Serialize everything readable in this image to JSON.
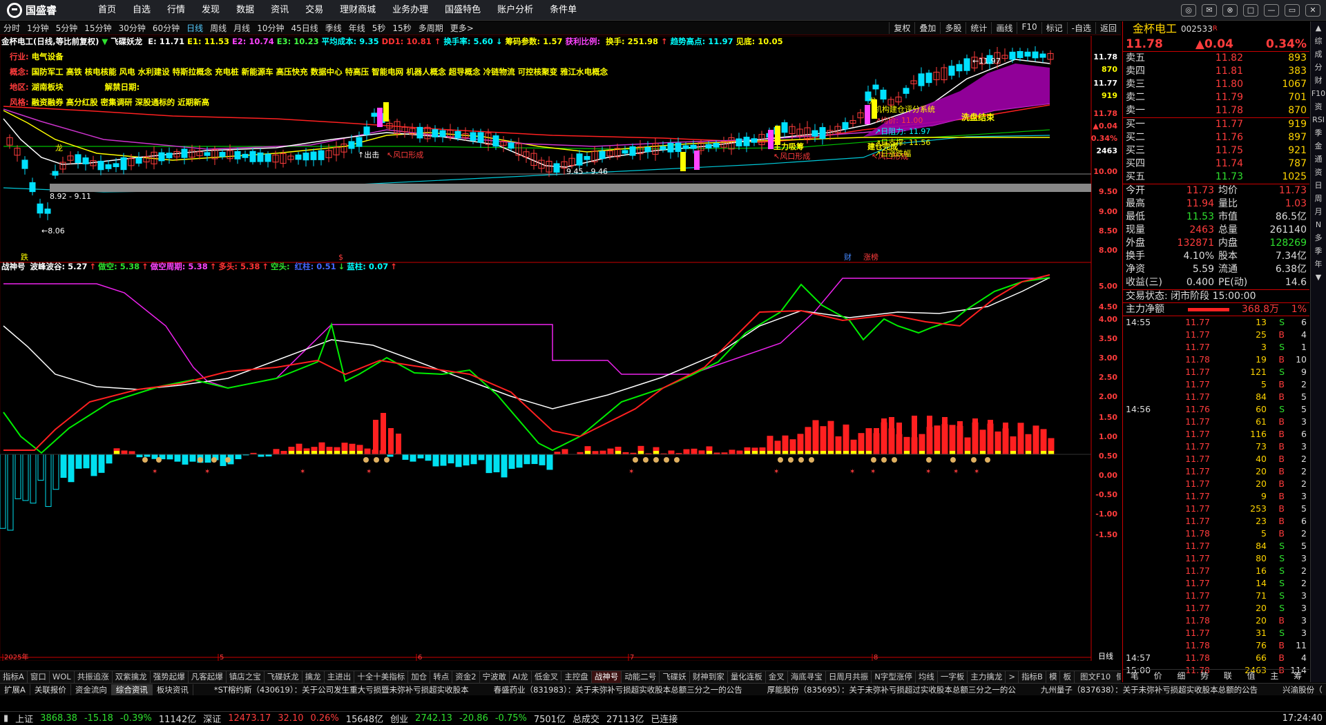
{
  "app": {
    "logo_text": "国盛睿"
  },
  "menu": [
    "首页",
    "自选",
    "行情",
    "发现",
    "数据",
    "资讯",
    "交易",
    "理财商城",
    "业务办理",
    "国盛特色",
    "账户分析",
    "条件单"
  ],
  "window_controls": [
    "◎",
    "✉",
    "⊗",
    "□",
    "—",
    "▭",
    "✕"
  ],
  "periods": [
    {
      "label": "分时",
      "on": false
    },
    {
      "label": "1分钟",
      "on": false
    },
    {
      "label": "5分钟",
      "on": false
    },
    {
      "label": "15分钟",
      "on": false
    },
    {
      "label": "30分钟",
      "on": false
    },
    {
      "label": "60分钟",
      "on": false
    },
    {
      "label": "日线",
      "on": true
    },
    {
      "label": "周线",
      "on": false
    },
    {
      "label": "月线",
      "on": false
    },
    {
      "label": "10分钟",
      "on": false
    },
    {
      "label": "45日线",
      "on": false
    },
    {
      "label": "季线",
      "on": false
    },
    {
      "label": "年线",
      "on": false
    },
    {
      "label": "5秒",
      "on": false
    },
    {
      "label": "15秒",
      "on": false
    },
    {
      "label": "多周期",
      "on": false
    },
    {
      "label": "更多>",
      "on": false
    }
  ],
  "toolbar": [
    "复权",
    "叠加",
    "多股",
    "统计",
    "画线",
    "F10",
    "标记",
    "-自选",
    "返回"
  ],
  "chart": {
    "header_items": [
      {
        "text": "金杯电工(日线,等比前复权)",
        "color": "#ffffff"
      },
      {
        "text": "▼",
        "color": "#2ee02e"
      },
      {
        "text": "飞碟妖龙 ",
        "color": "#ffffff"
      },
      {
        "text": "E: 11.71",
        "color": "#ffffff"
      },
      {
        "text": "E1: 11.53",
        "color": "#ffff00"
      },
      {
        "text": "E2: 10.74",
        "color": "#ff44ff"
      },
      {
        "text": "E3: 10.23",
        "color": "#44ff44"
      },
      {
        "text": "平均成本: 9.35",
        "color": "#00ffff"
      },
      {
        "text": "DD1: 10.81",
        "color": "#ff3333"
      },
      {
        "text": "↑",
        "color": "#ff3333"
      },
      {
        "text": "换手率: 5.60",
        "color": "#00ffff"
      },
      {
        "text": "↓",
        "color": "#00ffff"
      },
      {
        "text": "筹码参数: 1.57",
        "color": "#ffff00"
      },
      {
        "text": "获利比例: ",
        "color": "#ff44ff"
      },
      {
        "text": "换手: 251.98",
        "color": "#ffff00"
      },
      {
        "text": "↑",
        "color": "#ff3333"
      },
      {
        "text": "趋势高点: 11.97",
        "color": "#00ffff"
      },
      {
        "text": "见底: 10.05",
        "color": "#ffff00"
      }
    ],
    "info_lines": [
      {
        "label": "行业: ",
        "value": "电气设备"
      },
      {
        "label": "概念: ",
        "value": "国防军工 高铁 核电核能 风电 水利建设 特斯拉概念 充电桩 新能源车 高压快充 数据中心 特高压 智能电网 机器人概念 超导概念 冷链物流 可控核聚变 雅江水电概念"
      },
      {
        "label": "地区: ",
        "value": "湖南板块",
        "extra_label": "解禁日期: "
      },
      {
        "label": "风格: ",
        "value": "融资融券 高分红股 密集调研 深股通标的 近期新高"
      }
    ],
    "price_axis": [
      {
        "v": "11.78",
        "c": "#ffffff"
      },
      {
        "v": "870",
        "c": "#ffff00"
      },
      {
        "v": "11.77",
        "c": "#ffffff"
      },
      {
        "v": "919",
        "c": "#ffff00"
      },
      {
        "v": "11.78",
        "c": "#ff3c3c"
      },
      {
        "v": "▲0.04",
        "c": "#ff3c3c"
      },
      {
        "v": "0.34%",
        "c": "#ff3c3c"
      },
      {
        "v": "2463",
        "c": "#ffffff"
      },
      {
        "v": "10.00",
        "c": "#ff3c3c"
      },
      {
        "v": "9.50",
        "c": "#ff3c3c"
      },
      {
        "v": "9.00",
        "c": "#ff3c3c"
      },
      {
        "v": "8.50",
        "c": "#ff3c3c"
      },
      {
        "v": "8.00",
        "c": "#ff3c3c"
      }
    ],
    "price_marks": {
      "high": "11.97",
      "low": "8.06",
      "range1": "8.92 - 9.11",
      "range2": "9.45 - 9.46"
    },
    "annotations": {
      "long": "龙",
      "attack": "↑出击",
      "risk": "↖风口形成",
      "main_absorb": "主力吸筹",
      "build_done": "建仓完成",
      "wash_end": "洗盘结束",
      "lbl_trend": "机构建仓评分系统",
      "lbl_s1": "↗均价:",
      "lbl_v1": "11.00",
      "lbl_s2": "↗日阻力:",
      "lbl_v2": "11.97",
      "lbl_s3": "↗日支撑:",
      "lbl_v3": "11.56",
      "lbl_s4": "↗日涨跌幅",
      "lbl_jh": "红",
      "lbl_dragon": "龙"
    },
    "event_marks": {
      "fall": "跌",
      "s": "$",
      "cai": "财",
      "zhang": "涨榜"
    },
    "indicator_header": [
      {
        "text": "战神号 ",
        "color": "#ffffff"
      },
      {
        "text": "波峰波谷: 5.27",
        "color": "#ffffff"
      },
      {
        "text": "↑",
        "color": "#ff3333"
      },
      {
        "text": "做空: 5.38",
        "color": "#2ee02e"
      },
      {
        "text": "↑",
        "color": "#ff3333"
      },
      {
        "text": "做空周期: 5.38",
        "color": "#ff44ff"
      },
      {
        "text": "↑",
        "color": "#ff3333"
      },
      {
        "text": "多头: 5.38",
        "color": "#ff3333"
      },
      {
        "text": "↑",
        "color": "#ff3333"
      },
      {
        "text": "空头: ",
        "color": "#2ee02e"
      },
      {
        "text": "红柱: 0.51",
        "color": "#4466ff"
      },
      {
        "text": "↓",
        "color": "#2ee02e"
      },
      {
        "text": "蓝柱: 0.07",
        "color": "#00ffff"
      },
      {
        "text": "↑",
        "color": "#ff3333"
      }
    ],
    "ind_axis": [
      "5.00",
      "4.50",
      "4.00",
      "3.50",
      "3.00",
      "2.50",
      "2.00",
      "1.50",
      "1.00",
      "0.50",
      "0.00",
      "-0.50",
      "-1.00",
      "-1.50"
    ],
    "date_axis": [
      "2025年",
      "5",
      "6",
      "7",
      "8"
    ],
    "period_label": "日线"
  },
  "bottom_tabs": [
    "指标A",
    "窗口",
    "WOL",
    "共振追涨",
    "双紫擒龙",
    "强势起爆",
    "凡客起爆",
    "镇店之宝",
    "飞碟妖龙",
    "擒龙",
    "主进出",
    "十全十美指标",
    "加仓",
    "转点",
    "资金2",
    "宁波敢",
    "AI龙",
    "低金叉",
    "主控盘",
    "战神号",
    "动能二号",
    "飞碟妖",
    "财神到家",
    "量化连板",
    "金叉",
    "海底寻宝",
    "日周月共振",
    "N字型涨停",
    "均线",
    "一字板",
    "主力擒龙",
    ">",
    "指标B",
    "模",
    "板"
  ],
  "tabs_active": "战神号",
  "news_tabs": [
    "扩展A",
    "关联报价",
    "资金流向",
    "综合资讯",
    "板块资讯"
  ],
  "news": [
    "*ST榕约斯（430619）：关于公司发生重大亏损暨未弥补亏损超实收股本",
    "春盛药业（831983）：关于未弥补亏损超实收股本总额三分之一的公告",
    "厚能股份（835695）：关于未弥补亏损超过实收股本总额三分之一的公",
    "九州量子（837638）：关于未弥补亏损超实收股本总额的公告",
    "兴渝股份（"
  ],
  "status": {
    "sh_label": "上证",
    "sh_val": "3868.38",
    "sh_chg": "-15.18",
    "sh_pct": "-0.39%",
    "sh_amt": "11142亿",
    "sz_label": "深证",
    "sz_val": "12473.17",
    "sz_chg": "32.10",
    "sz_pct": "0.26%",
    "sz_amt": "15648亿",
    "cy_label": "创业",
    "cy_val": "2742.13",
    "cy_chg": "-20.86",
    "cy_pct": "-0.75%",
    "cy_amt": "7501亿",
    "total_label": "总成交",
    "total_amt": "27113亿",
    "conn": "已连接",
    "time": "17:24:40"
  },
  "quote": {
    "name": "金杯电工",
    "code": "002533",
    "r": "R",
    "price": "11.78",
    "change": "▲0.04",
    "pct": "0.34%",
    "asks": [
      {
        "l": "卖五",
        "p": "11.82",
        "v": "893"
      },
      {
        "l": "卖四",
        "p": "11.81",
        "v": "383"
      },
      {
        "l": "卖三",
        "p": "11.80",
        "v": "1067"
      },
      {
        "l": "卖二",
        "p": "11.79",
        "v": "701"
      },
      {
        "l": "卖一",
        "p": "11.78",
        "v": "870"
      }
    ],
    "bids": [
      {
        "l": "买一",
        "p": "11.77",
        "v": "919"
      },
      {
        "l": "买二",
        "p": "11.76",
        "v": "897"
      },
      {
        "l": "买三",
        "p": "11.75",
        "v": "921"
      },
      {
        "l": "买四",
        "p": "11.74",
        "v": "787"
      },
      {
        "l": "买五",
        "p": "11.73",
        "v": "1025"
      }
    ],
    "stats": [
      {
        "a": "今开",
        "av": "11.73",
        "ac": "red",
        "b": "均价",
        "bv": "11.73",
        "bc": "red"
      },
      {
        "a": "最高",
        "av": "11.94",
        "ac": "red",
        "b": "量比",
        "bv": "1.03",
        "bc": "red"
      },
      {
        "a": "最低",
        "av": "11.53",
        "ac": "grn",
        "b": "市值",
        "bv": "86.5亿",
        "bc": "wht"
      },
      {
        "a": "现量",
        "av": "2463",
        "ac": "red",
        "b": "总量",
        "bv": "261140",
        "bc": "wht"
      },
      {
        "a": "外盘",
        "av": "132871",
        "ac": "red",
        "b": "内盘",
        "bv": "128269",
        "bc": "grn"
      },
      {
        "a": "换手",
        "av": "4.10%",
        "ac": "wht",
        "b": "股本",
        "bv": "7.34亿",
        "bc": "wht"
      },
      {
        "a": "净资",
        "av": "5.59",
        "ac": "wht",
        "b": "流通",
        "bv": "6.38亿",
        "bc": "wht"
      },
      {
        "a": "收益(三)",
        "av": "0.400",
        "ac": "wht",
        "b": "PE(动)",
        "bv": "14.6",
        "bc": "wht"
      }
    ],
    "trade_status": "交易状态: 闭市阶段 15:00:00",
    "flow_label": "主力净额",
    "flow_val": "368.8万",
    "flow_pct": "1%",
    "ticks": [
      {
        "t": "14:55",
        "p": "11.77",
        "v": "13",
        "d": "S",
        "n": "6"
      },
      {
        "t": "",
        "p": "11.77",
        "v": "25",
        "d": "B",
        "n": "4"
      },
      {
        "t": "",
        "p": "11.77",
        "v": "3",
        "d": "S",
        "n": "1"
      },
      {
        "t": "",
        "p": "11.78",
        "v": "19",
        "d": "B",
        "n": "10"
      },
      {
        "t": "",
        "p": "11.77",
        "v": "121",
        "d": "S",
        "n": "9"
      },
      {
        "t": "",
        "p": "11.77",
        "v": "5",
        "d": "B",
        "n": "2"
      },
      {
        "t": "",
        "p": "11.77",
        "v": "84",
        "d": "B",
        "n": "5"
      },
      {
        "t": "14:56",
        "p": "11.76",
        "v": "60",
        "d": "S",
        "n": "5"
      },
      {
        "t": "",
        "p": "11.77",
        "v": "61",
        "d": "B",
        "n": "3"
      },
      {
        "t": "",
        "p": "11.77",
        "v": "116",
        "d": "B",
        "n": "6"
      },
      {
        "t": "",
        "p": "11.77",
        "v": "73",
        "d": "B",
        "n": "3"
      },
      {
        "t": "",
        "p": "11.77",
        "v": "40",
        "d": "B",
        "n": "2"
      },
      {
        "t": "",
        "p": "11.77",
        "v": "20",
        "d": "B",
        "n": "2"
      },
      {
        "t": "",
        "p": "11.77",
        "v": "20",
        "d": "B",
        "n": "2"
      },
      {
        "t": "",
        "p": "11.77",
        "v": "9",
        "d": "B",
        "n": "3"
      },
      {
        "t": "",
        "p": "11.77",
        "v": "253",
        "d": "B",
        "n": "5"
      },
      {
        "t": "",
        "p": "11.77",
        "v": "23",
        "d": "B",
        "n": "6"
      },
      {
        "t": "",
        "p": "11.78",
        "v": "5",
        "d": "B",
        "n": "2"
      },
      {
        "t": "",
        "p": "11.77",
        "v": "84",
        "d": "S",
        "n": "5"
      },
      {
        "t": "",
        "p": "11.77",
        "v": "80",
        "d": "S",
        "n": "3"
      },
      {
        "t": "",
        "p": "11.77",
        "v": "16",
        "d": "S",
        "n": "2"
      },
      {
        "t": "",
        "p": "11.77",
        "v": "14",
        "d": "S",
        "n": "2"
      },
      {
        "t": "",
        "p": "11.77",
        "v": "71",
        "d": "S",
        "n": "3"
      },
      {
        "t": "",
        "p": "11.77",
        "v": "20",
        "d": "S",
        "n": "3"
      },
      {
        "t": "",
        "p": "11.78",
        "v": "20",
        "d": "B",
        "n": "3"
      },
      {
        "t": "",
        "p": "11.77",
        "v": "31",
        "d": "S",
        "n": "3"
      },
      {
        "t": "",
        "p": "11.78",
        "v": "76",
        "d": "B",
        "n": "11"
      },
      {
        "t": "14:57",
        "p": "11.78",
        "v": "66",
        "d": "B",
        "n": "4"
      },
      {
        "t": "15:00",
        "p": "11.78",
        "v": "2463",
        "d": "B",
        "n": "114"
      }
    ],
    "bottom_tabs": [
      "笔",
      "价",
      "细",
      "势",
      "联",
      "值",
      "主",
      "筹"
    ],
    "f10_tabs": [
      "图文F10",
      "侧边栏《"
    ]
  },
  "sidebar": [
    "▲",
    "综",
    "成",
    "分",
    "财",
    "F10",
    "资",
    "RSI",
    "季",
    "金",
    "通",
    "资",
    "日",
    "周",
    "月",
    "N",
    "多",
    "季",
    "年",
    "▼"
  ]
}
